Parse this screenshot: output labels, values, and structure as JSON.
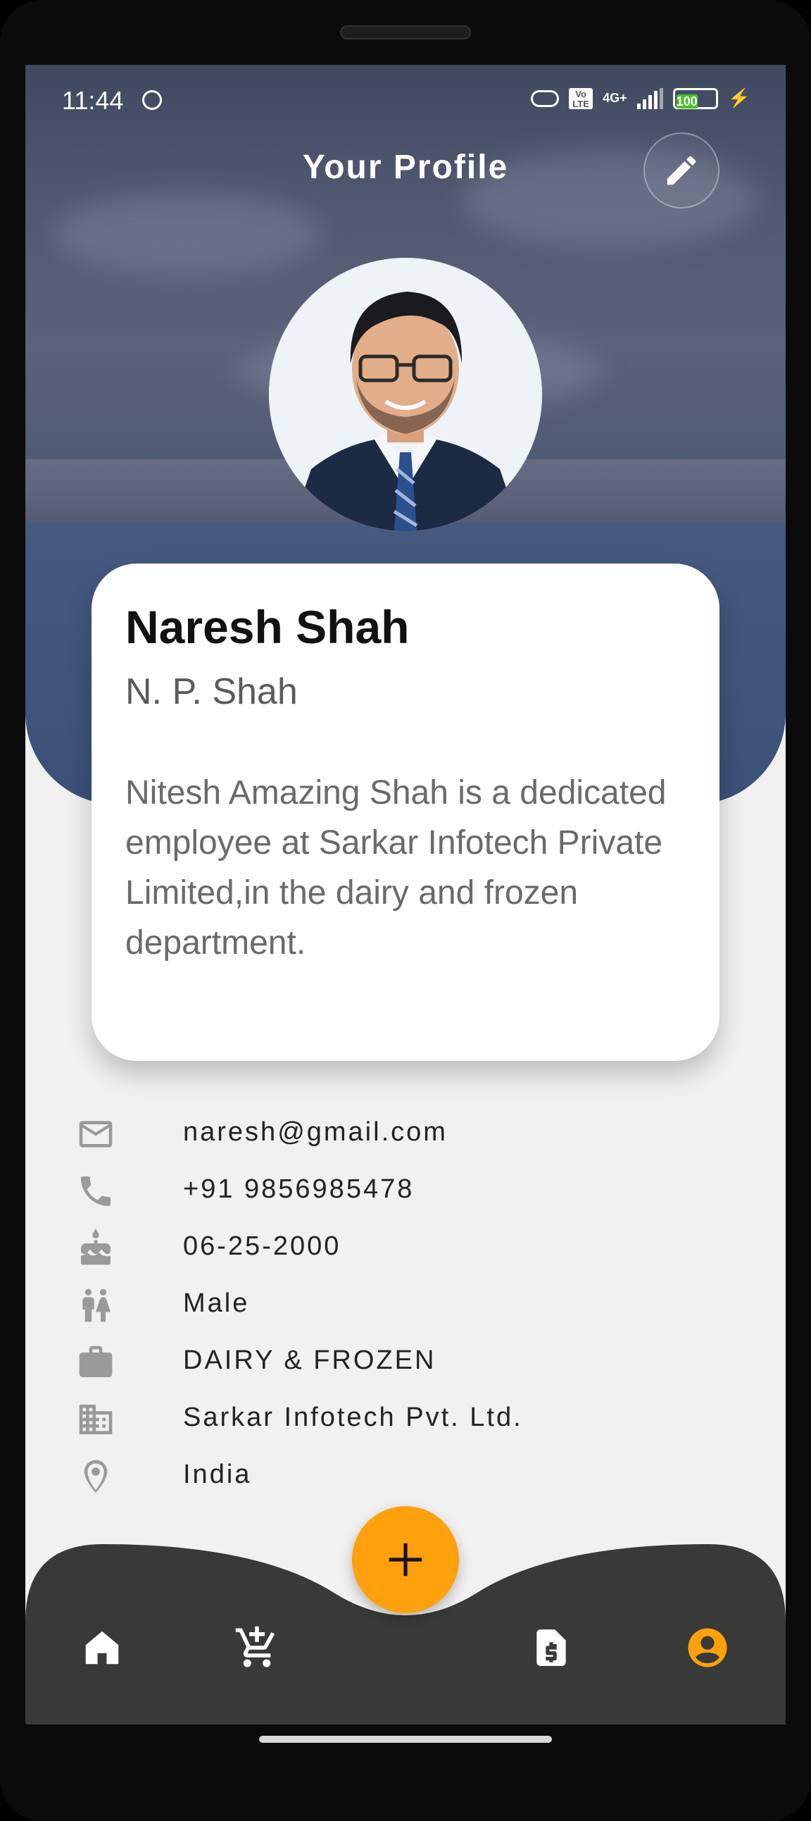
{
  "status_bar": {
    "time": "11:44",
    "network": "4G+",
    "battery": "100",
    "battery_color": "#47c12c"
  },
  "app_bar": {
    "title": "Your Profile",
    "edit_icon": "pencil-icon"
  },
  "profile": {
    "name": "Naresh Shah",
    "short_name": "N. P. Shah",
    "bio": "Nitesh Amazing Shah is a dedicated employee at Sarkar Infotech Private Limited,in the dairy and frozen department."
  },
  "details": [
    {
      "icon": "email-icon",
      "value": "naresh@gmail.com"
    },
    {
      "icon": "phone-icon",
      "value": "+91 9856985478"
    },
    {
      "icon": "cake-icon",
      "value": "06-25-2000"
    },
    {
      "icon": "gender-icon",
      "value": "Male"
    },
    {
      "icon": "briefcase-icon",
      "value": "DAIRY & FROZEN"
    },
    {
      "icon": "building-icon",
      "value": "Sarkar Infotech Pvt. Ltd."
    },
    {
      "icon": "location-icon",
      "value": "India"
    }
  ],
  "bottom_nav": {
    "items": [
      {
        "icon": "home-icon"
      },
      {
        "icon": "add-cart-icon"
      },
      {
        "icon": "invoice-icon"
      },
      {
        "icon": "account-icon",
        "active": true
      }
    ],
    "fab_icon": "plus-icon",
    "bar_color": "#373a37",
    "accent_color": "#ffa10c"
  }
}
